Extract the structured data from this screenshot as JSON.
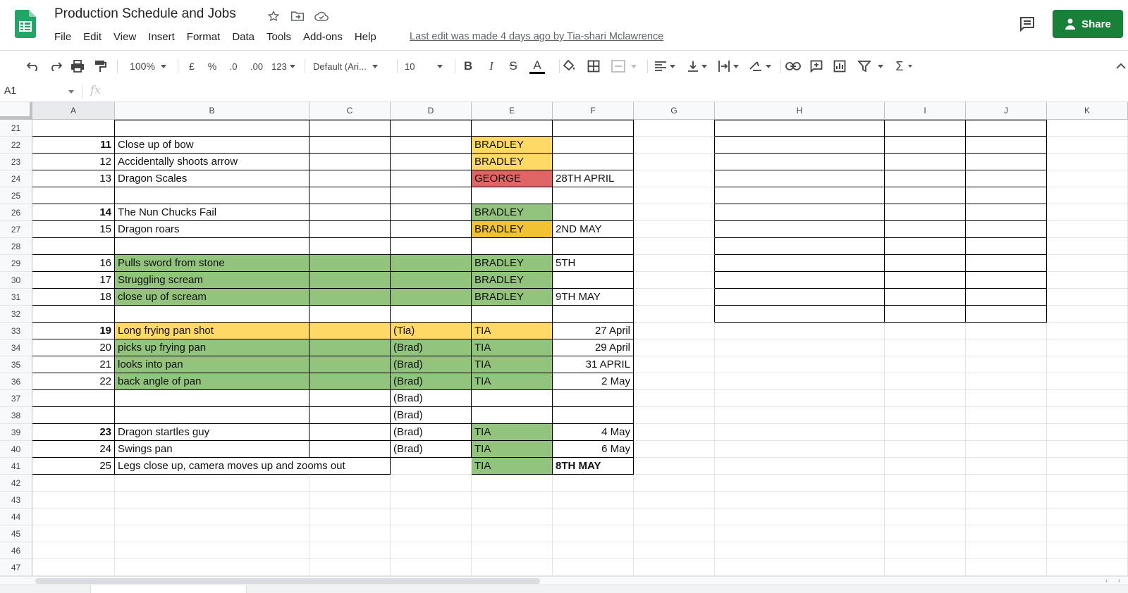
{
  "app": {
    "title": "Production Schedule and Jobs",
    "menu": [
      "File",
      "Edit",
      "View",
      "Insert",
      "Format",
      "Data",
      "Tools",
      "Add-ons",
      "Help"
    ],
    "last_edit": "Last edit was made 4 days ago by Tia-shari Mclawrence",
    "share_label": "Share"
  },
  "toolbar": {
    "zoom": "100%",
    "currency": "£",
    "percent": "%",
    "dec_less": ".0",
    "dec_more": ".00",
    "format_more": "123",
    "font": "Default (Ari...",
    "font_size": "10"
  },
  "formula_bar": {
    "name_box": "A1",
    "fx": "fx"
  },
  "columns": [
    "A",
    "B",
    "C",
    "D",
    "E",
    "F",
    "G",
    "H",
    "I",
    "J",
    "K"
  ],
  "rows": [
    {
      "n": "21"
    },
    {
      "n": "22",
      "a": "11",
      "b": "Close up of bow",
      "e": "BRADLEY"
    },
    {
      "n": "23",
      "a": "12",
      "b": "Accidentally shoots arrow",
      "e": "BRADLEY"
    },
    {
      "n": "24",
      "a": "13",
      "b": "Dragon Scales",
      "e": "GEORGE",
      "f": "28TH APRIL"
    },
    {
      "n": "25"
    },
    {
      "n": "26",
      "a": "14",
      "b": "The Nun Chucks Fail",
      "e": "BRADLEY"
    },
    {
      "n": "27",
      "a": "15",
      "b": "Dragon roars",
      "e": "BRADLEY",
      "f": "2ND MAY"
    },
    {
      "n": "28"
    },
    {
      "n": "29",
      "a": "16",
      "b": "Pulls sword from stone",
      "e": "BRADLEY",
      "f": "5TH"
    },
    {
      "n": "30",
      "a": "17",
      "b": "Struggling scream",
      "e": "BRADLEY"
    },
    {
      "n": "31",
      "a": "18",
      "b": "close up of scream",
      "e": "BRADLEY",
      "f": "9TH MAY"
    },
    {
      "n": "32"
    },
    {
      "n": "33",
      "a": "19",
      "b": "Long frying pan shot",
      "d": "(Tia)",
      "e": "TIA",
      "f": "27 April"
    },
    {
      "n": "34",
      "a": "20",
      "b": "picks up frying pan",
      "d": "(Brad)",
      "e": "TIA",
      "f": "29 April"
    },
    {
      "n": "35",
      "a": "21",
      "b": "looks into pan",
      "d": "(Brad)",
      "e": "TIA",
      "f": "31 APRIL"
    },
    {
      "n": "36",
      "a": "22",
      "b": "back angle of pan",
      "d": "(Brad)",
      "e": "TIA",
      "f": "2 May"
    },
    {
      "n": "37",
      "d": "(Brad)"
    },
    {
      "n": "38",
      "d": "(Brad)"
    },
    {
      "n": "39",
      "a": "23",
      "b": "Dragon startles guy",
      "d": "(Brad)",
      "e": "TIA",
      "f": "4 May"
    },
    {
      "n": "40",
      "a": "24",
      "b": "Swings pan",
      "d": "(Brad)",
      "e": "TIA",
      "f": "6 May"
    },
    {
      "n": "41",
      "a": "25",
      "b": "Legs close up, camera moves up and zooms out",
      "e": "TIA",
      "f": "8TH MAY"
    },
    {
      "n": "42"
    },
    {
      "n": "43"
    },
    {
      "n": "44"
    },
    {
      "n": "45"
    },
    {
      "n": "46"
    },
    {
      "n": "47"
    }
  ],
  "colors": {
    "green": "#93c47d",
    "yellow": "#ffd966",
    "orange": "#f1c232",
    "red": "#e06666",
    "share": "#188038"
  }
}
